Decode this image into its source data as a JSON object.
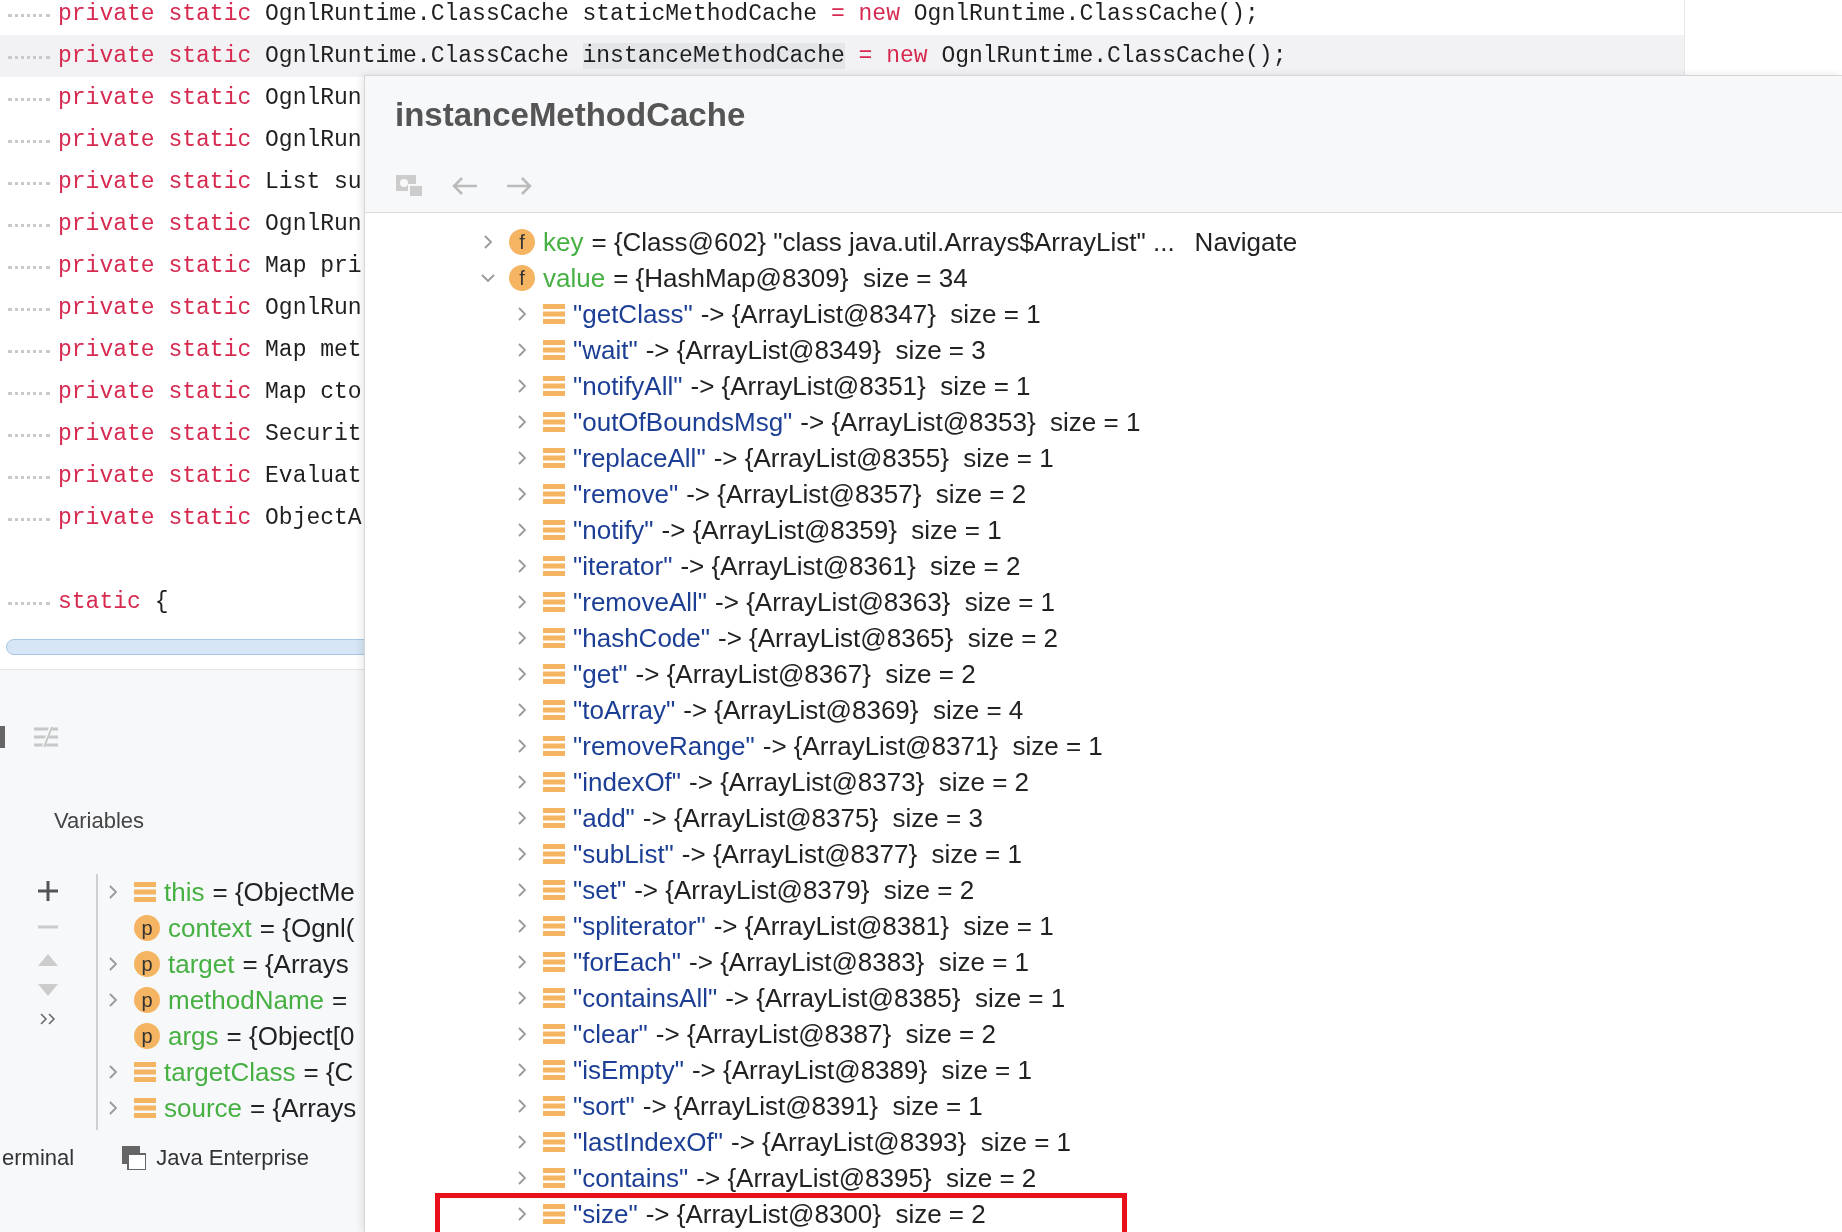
{
  "editor": {
    "lines": [
      {
        "current": false,
        "segments": [
          {
            "kind": "keyword",
            "text": "private static "
          },
          {
            "kind": "plain",
            "text": "OgnlRuntime.ClassCache staticMethodCache "
          },
          {
            "kind": "keyword",
            "text": "= new "
          },
          {
            "kind": "plain",
            "text": "OgnlRuntime.ClassCache();"
          }
        ]
      },
      {
        "current": true,
        "segments": [
          {
            "kind": "keyword",
            "text": "private static "
          },
          {
            "kind": "plain",
            "text": "OgnlRuntime.ClassCache "
          },
          {
            "kind": "usage",
            "text": "instanceMethodCache"
          },
          {
            "kind": "keyword",
            "text": " = new "
          },
          {
            "kind": "plain",
            "text": "OgnlRuntime.ClassCache();"
          }
        ]
      },
      {
        "current": false,
        "segments": [
          {
            "kind": "keyword",
            "text": "private static "
          },
          {
            "kind": "plain",
            "text": "OgnlRun"
          }
        ]
      },
      {
        "current": false,
        "segments": [
          {
            "kind": "keyword",
            "text": "private static "
          },
          {
            "kind": "plain",
            "text": "OgnlRun"
          }
        ]
      },
      {
        "current": false,
        "segments": [
          {
            "kind": "keyword",
            "text": "private static "
          },
          {
            "kind": "plain",
            "text": "List su"
          }
        ]
      },
      {
        "current": false,
        "segments": [
          {
            "kind": "keyword",
            "text": "private static "
          },
          {
            "kind": "plain",
            "text": "OgnlRun"
          }
        ]
      },
      {
        "current": false,
        "segments": [
          {
            "kind": "keyword",
            "text": "private static "
          },
          {
            "kind": "plain",
            "text": "Map pri"
          }
        ]
      },
      {
        "current": false,
        "segments": [
          {
            "kind": "keyword",
            "text": "private static "
          },
          {
            "kind": "plain",
            "text": "OgnlRun"
          }
        ]
      },
      {
        "current": false,
        "segments": [
          {
            "kind": "keyword",
            "text": "private static "
          },
          {
            "kind": "plain",
            "text": "Map met"
          }
        ]
      },
      {
        "current": false,
        "segments": [
          {
            "kind": "keyword",
            "text": "private static "
          },
          {
            "kind": "plain",
            "text": "Map cto"
          }
        ]
      },
      {
        "current": false,
        "segments": [
          {
            "kind": "keyword",
            "text": "private static "
          },
          {
            "kind": "plain",
            "text": "Securit"
          }
        ]
      },
      {
        "current": false,
        "segments": [
          {
            "kind": "keyword",
            "text": "private static "
          },
          {
            "kind": "plain",
            "text": "Evaluat"
          }
        ]
      },
      {
        "current": false,
        "segments": [
          {
            "kind": "keyword",
            "text": "private static "
          },
          {
            "kind": "plain",
            "text": "ObjectA"
          }
        ]
      },
      {
        "current": false
      },
      {
        "current": false,
        "segments": [
          {
            "kind": "keyword",
            "text": "static "
          },
          {
            "kind": "plain",
            "text": "{"
          }
        ]
      }
    ]
  },
  "debugger": {
    "panel_title": "Variables",
    "variables": [
      {
        "kind": "field",
        "expandable": true,
        "name": "this",
        "value": "= {ObjectMe"
      },
      {
        "kind": "param",
        "badge": "p",
        "expandable": false,
        "name": "context",
        "value": "= {Ognl("
      },
      {
        "kind": "param",
        "badge": "p",
        "expandable": true,
        "name": "target",
        "value": "= {Arrays"
      },
      {
        "kind": "param",
        "badge": "p",
        "expandable": true,
        "name": "methodName",
        "value": "="
      },
      {
        "kind": "param",
        "badge": "p",
        "expandable": false,
        "name": "args",
        "value": "= {Object[0"
      },
      {
        "kind": "field",
        "expandable": true,
        "name": "targetClass",
        "value": "= {C"
      },
      {
        "kind": "field",
        "expandable": true,
        "name": "source",
        "value": "= {Arrays"
      }
    ]
  },
  "tool_tabs": [
    "erminal",
    "Java Enterprise"
  ],
  "popup": {
    "title": "instanceMethodCache",
    "nodes": [
      {
        "kind": "field",
        "badge": "f",
        "expanded": false,
        "name": "key",
        "value": "= {Class@602} \"class java.util.Arrays$ArrayList\" ...",
        "link": "Navigate"
      },
      {
        "kind": "field",
        "badge": "f",
        "expanded": true,
        "name": "value",
        "value": "= {HashMap@8309}  size = 34",
        "children": [
          {
            "kind": "entry",
            "highlighted": false,
            "key": "\"getClass\"",
            "value": "-> {ArrayList@8347}  size = 1"
          },
          {
            "kind": "entry",
            "highlighted": false,
            "key": "\"wait\"",
            "value": "-> {ArrayList@8349}  size = 3"
          },
          {
            "kind": "entry",
            "highlighted": false,
            "key": "\"notifyAll\"",
            "value": "-> {ArrayList@8351}  size = 1"
          },
          {
            "kind": "entry",
            "highlighted": false,
            "key": "\"outOfBoundsMsg\"",
            "value": "-> {ArrayList@8353}  size = 1"
          },
          {
            "kind": "entry",
            "highlighted": false,
            "key": "\"replaceAll\"",
            "value": "-> {ArrayList@8355}  size = 1"
          },
          {
            "kind": "entry",
            "highlighted": false,
            "key": "\"remove\"",
            "value": "-> {ArrayList@8357}  size = 2"
          },
          {
            "kind": "entry",
            "highlighted": false,
            "key": "\"notify\"",
            "value": "-> {ArrayList@8359}  size = 1"
          },
          {
            "kind": "entry",
            "highlighted": false,
            "key": "\"iterator\"",
            "value": "-> {ArrayList@8361}  size = 2"
          },
          {
            "kind": "entry",
            "highlighted": false,
            "key": "\"removeAll\"",
            "value": "-> {ArrayList@8363}  size = 1"
          },
          {
            "kind": "entry",
            "highlighted": false,
            "key": "\"hashCode\"",
            "value": "-> {ArrayList@8365}  size = 2"
          },
          {
            "kind": "entry",
            "highlighted": false,
            "key": "\"get\"",
            "value": "-> {ArrayList@8367}  size = 2"
          },
          {
            "kind": "entry",
            "highlighted": false,
            "key": "\"toArray\"",
            "value": "-> {ArrayList@8369}  size = 4"
          },
          {
            "kind": "entry",
            "highlighted": false,
            "key": "\"removeRange\"",
            "value": "-> {ArrayList@8371}  size = 1"
          },
          {
            "kind": "entry",
            "highlighted": false,
            "key": "\"indexOf\"",
            "value": "-> {ArrayList@8373}  size = 2"
          },
          {
            "kind": "entry",
            "highlighted": false,
            "key": "\"add\"",
            "value": "-> {ArrayList@8375}  size = 3"
          },
          {
            "kind": "entry",
            "highlighted": false,
            "key": "\"subList\"",
            "value": "-> {ArrayList@8377}  size = 1"
          },
          {
            "kind": "entry",
            "highlighted": false,
            "key": "\"set\"",
            "value": "-> {ArrayList@8379}  size = 2"
          },
          {
            "kind": "entry",
            "highlighted": false,
            "key": "\"spliterator\"",
            "value": "-> {ArrayList@8381}  size = 1"
          },
          {
            "kind": "entry",
            "highlighted": false,
            "key": "\"forEach\"",
            "value": "-> {ArrayList@8383}  size = 1"
          },
          {
            "kind": "entry",
            "highlighted": false,
            "key": "\"containsAll\"",
            "value": "-> {ArrayList@8385}  size = 1"
          },
          {
            "kind": "entry",
            "highlighted": false,
            "key": "\"clear\"",
            "value": "-> {ArrayList@8387}  size = 2"
          },
          {
            "kind": "entry",
            "highlighted": false,
            "key": "\"isEmpty\"",
            "value": "-> {ArrayList@8389}  size = 1"
          },
          {
            "kind": "entry",
            "highlighted": false,
            "key": "\"sort\"",
            "value": "-> {ArrayList@8391}  size = 1"
          },
          {
            "kind": "entry",
            "highlighted": false,
            "key": "\"lastIndexOf\"",
            "value": "-> {ArrayList@8393}  size = 1"
          },
          {
            "kind": "entry",
            "highlighted": false,
            "key": "\"contains\"",
            "value": "-> {ArrayList@8395}  size = 2"
          },
          {
            "kind": "entry",
            "highlighted": true,
            "key": "\"size\"",
            "value": "-> {ArrayList@8300}  size = 2"
          }
        ]
      }
    ]
  }
}
